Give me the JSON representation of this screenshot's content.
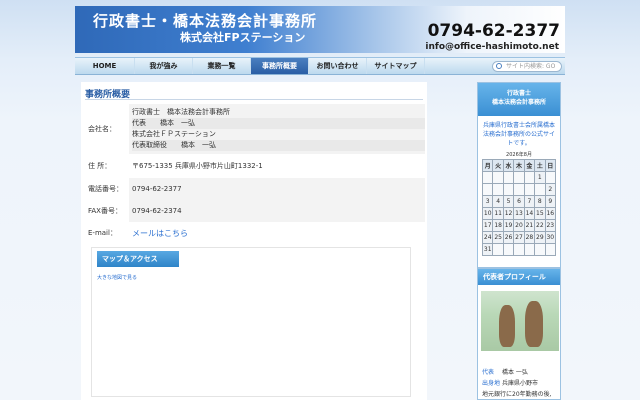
{
  "header": {
    "title": "行政書士・橋本法務会計事務所",
    "subtitle": "株式会社FPステーション",
    "phone": "0794-62-2377",
    "email": "info@office-hashimoto.net"
  },
  "nav": {
    "items": [
      "HOME",
      "我が強み",
      "業務一覧",
      "事務所概要",
      "お問い合わせ",
      "サイトマップ"
    ],
    "active_index": 3,
    "search_placeholder": "サイト内検索: GO"
  },
  "main": {
    "heading": "事務所概要",
    "company_label": "会社名：",
    "company_lines": [
      "行政書士　橋本法務会計事務所",
      "代表　　橋本　一弘",
      "株式会社ＦＰステーション",
      "代表取締役　　橋本　一弘"
    ],
    "address_label": "住 所：",
    "address": "〒675-1335 兵庫県小野市片山町1332-1",
    "tel_label": "電話番号：",
    "tel": "0794-62-2377",
    "fax_label": "FAX番号：",
    "fax": "0794-62-2374",
    "email_label": "E-mail：",
    "email_link": "メールはこちら",
    "map_tab": "マップ＆アクセス",
    "map_link": "大きな地図で見る"
  },
  "sidebar": {
    "box1_head_line1": "行政書士",
    "box1_head_line2": "橋本法務会計事務所",
    "box1_desc": "兵庫県行政書士会所属橋本法務会計事務所の公式サイトです。",
    "calendar": {
      "caption": "2026年8月",
      "weekdays": [
        "月",
        "火",
        "水",
        "木",
        "金",
        "土",
        "日"
      ],
      "weeks": [
        [
          "",
          "",
          "",
          "",
          "",
          "1",
          ""
        ],
        [
          "",
          "",
          "",
          "",
          "",
          "",
          "2"
        ],
        [
          "3",
          "4",
          "5",
          "6",
          "7",
          "8",
          "9"
        ],
        [
          "10",
          "11",
          "12",
          "13",
          "14",
          "15",
          "16"
        ],
        [
          "17",
          "18",
          "19",
          "20",
          "21",
          "22",
          "23"
        ],
        [
          "24",
          "25",
          "26",
          "27",
          "28",
          "29",
          "30"
        ],
        [
          "31",
          "",
          "",
          "",
          "",
          "",
          ""
        ]
      ]
    },
    "profile_head": "代表者プロフィール",
    "profile": {
      "name_label": "代表",
      "name": "橋本 一弘",
      "origin_label": "出身地",
      "origin": "兵庫県小野市",
      "career": "地元銀行に20年勤務の後,"
    }
  }
}
